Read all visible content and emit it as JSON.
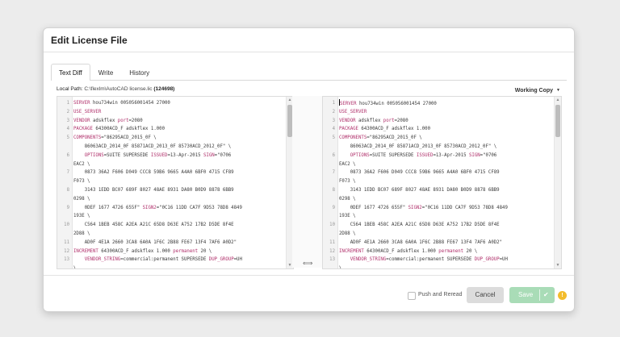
{
  "dialog": {
    "title": "Edit License File",
    "tabs": [
      {
        "label": "Text Diff",
        "active": true
      },
      {
        "label": "Write",
        "active": false
      },
      {
        "label": "History",
        "active": false
      }
    ],
    "path_label": "Local Path:",
    "path_value": "C:\\flexlm\\AutoCAD license.lic",
    "path_count": "(124698)",
    "version_select": "Working Copy",
    "push_reread_label": "Push and Reread",
    "cancel_label": "Cancel",
    "save_label": "Save",
    "warning_icon": "warning-icon",
    "colors": {
      "save_button": "#a9dcb7",
      "keyword": "#b0306b",
      "warning": "#f3bc2c"
    }
  },
  "diff": {
    "left": [
      {
        "num": "1",
        "kw": "SERVER",
        "rest": " hou734win 005056001454 27000"
      },
      {
        "num": "2",
        "kw": "USE_SERVER",
        "rest": ""
      },
      {
        "num": "3",
        "kw": "VENDOR",
        "rest": " adskflex ",
        "kw2": "port",
        "rest2": "=2080"
      },
      {
        "num": "4",
        "kw": "PACKAGE",
        "rest": " 64300ACD_F adskflex 1.000"
      },
      {
        "num": "5",
        "kw": "COMPONENTS",
        "rest": "=\"86295ACD_2015_0F \\"
      },
      {
        "num": "",
        "kw": "",
        "rest": "    86063ACD_2014_0F 85871ACD_2013_0F 85730ACD_2012_0F\" \\"
      },
      {
        "num": "6",
        "kw": "",
        "rest": "    ",
        "kw2": "OPTIONS",
        "rest2": "=SUITE SUPERSEDE ",
        "kw3": "ISSUED",
        "rest3": "=13-Apr-2015 ",
        "kw4": "SIGN",
        "rest4": "=\"0706"
      },
      {
        "num": "",
        "kw": "",
        "rest": "EAC2 \\"
      },
      {
        "num": "7",
        "kw": "",
        "rest": "    0873 36A2 F606 D049 CCC8 59B6 9665 A4A0 6BF0 4715 CF89"
      },
      {
        "num": "",
        "kw": "",
        "rest": "F073 \\"
      },
      {
        "num": "8",
        "kw": "",
        "rest": "    3143 1EDD BC07 689F 8027 48AE 8931 DA80 B0D9 8878 6BB9"
      },
      {
        "num": "",
        "kw": "",
        "rest": "0298 \\"
      },
      {
        "num": "9",
        "kw": "",
        "rest": "    0DEF 1677 4726 655F\" ",
        "kw2": "SIGN2",
        "rest2": "=\"0C16 11DD CA7F 9D53 78D8 4849"
      },
      {
        "num": "",
        "kw": "",
        "rest": "193E \\"
      },
      {
        "num": "10",
        "kw": "",
        "rest": "    C564 1BEB 458C A2EA A21C 65D8 D63E A752 17B2 D5DE 8F4E"
      },
      {
        "num": "",
        "kw": "",
        "rest": "2D88 \\"
      },
      {
        "num": "11",
        "kw": "",
        "rest": "    AD0F 4E1A 2660 3CA8 6A0A 1F6C 2B88 FE67 13F4 7AF6 A0D2\""
      },
      {
        "num": "12",
        "kw": "INCREMENT",
        "rest": " 64300ACD_F adskflex 1.000 ",
        "kw2": "permanent",
        "rest2": " 20 \\"
      },
      {
        "num": "13",
        "kw": "",
        "rest": "    ",
        "kw2": "VENDOR_STRING",
        "rest2": "=commercial:permanent SUPERSEDE ",
        "kw3": "DUP_GROUP",
        "rest3": "=UH"
      },
      {
        "num": "",
        "kw": "",
        "rest": "\\"
      }
    ],
    "right": [
      {
        "num": "1",
        "kw": "SERVER",
        "rest": " hou734win 005056001454 27000",
        "cursor": true
      },
      {
        "num": "2",
        "kw": "USE_SERVER",
        "rest": ""
      },
      {
        "num": "3",
        "kw": "VENDOR",
        "rest": " adskflex ",
        "kw2": "port",
        "rest2": "=2080"
      },
      {
        "num": "4",
        "kw": "PACKAGE",
        "rest": " 64300ACD_F adskflex 1.000"
      },
      {
        "num": "5",
        "kw": "COMPONENTS",
        "rest": "=\"86295ACD_2015_0F \\"
      },
      {
        "num": "",
        "kw": "",
        "rest": "    86063ACD_2014_0F 85871ACD_2013_0F 85730ACD_2012_0F\" \\"
      },
      {
        "num": "6",
        "kw": "",
        "rest": "    ",
        "kw2": "OPTIONS",
        "rest2": "=SUITE SUPERSEDE ",
        "kw3": "ISSUED",
        "rest3": "=13-Apr-2015 ",
        "kw4": "SIGN",
        "rest4": "=\"0706"
      },
      {
        "num": "",
        "kw": "",
        "rest": "EAC2 \\"
      },
      {
        "num": "7",
        "kw": "",
        "rest": "    0873 36A2 F606 D049 CCC8 59B6 9665 A4A0 6BF0 4715 CF89"
      },
      {
        "num": "",
        "kw": "",
        "rest": "F073 \\"
      },
      {
        "num": "8",
        "kw": "",
        "rest": "    3143 1EDD BC07 689F 8027 48AE 8931 DA80 B0D9 8878 6BB9"
      },
      {
        "num": "",
        "kw": "",
        "rest": "0298 \\"
      },
      {
        "num": "9",
        "kw": "",
        "rest": "    0DEF 1677 4726 655F\" ",
        "kw2": "SIGN2",
        "rest2": "=\"0C16 11DD CA7F 9D53 78D8 4849"
      },
      {
        "num": "",
        "kw": "",
        "rest": "193E \\"
      },
      {
        "num": "10",
        "kw": "",
        "rest": "    C564 1BEB 458C A2EA A21C 65D8 D63E A752 17B2 D5DE 8F4E"
      },
      {
        "num": "",
        "kw": "",
        "rest": "2D88 \\"
      },
      {
        "num": "11",
        "kw": "",
        "rest": "    AD0F 4E1A 2660 3CA8 6A0A 1F6C 2B88 FE67 13F4 7AF6 A0D2\""
      },
      {
        "num": "12",
        "kw": "INCREMENT",
        "rest": " 64300ACD_F adskflex 1.000 ",
        "kw2": "permanent",
        "rest2": " 20 \\"
      },
      {
        "num": "13",
        "kw": "",
        "rest": "    ",
        "kw2": "VENDOR_STRING",
        "rest2": "=commercial:permanent SUPERSEDE ",
        "kw3": "DUP_GROUP",
        "rest3": "=UH"
      },
      {
        "num": "",
        "kw": "",
        "rest": "\\"
      }
    ]
  }
}
